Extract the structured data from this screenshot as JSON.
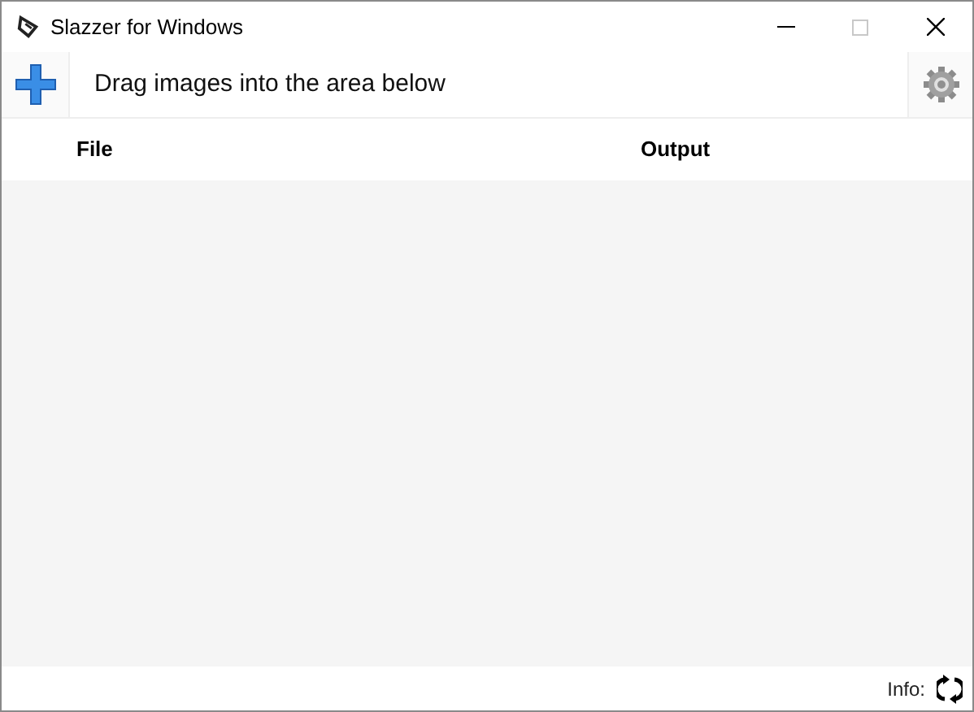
{
  "window": {
    "title": "Slazzer for Windows",
    "maximize_disabled": true
  },
  "toolbar": {
    "hint": "Drag images into the area below"
  },
  "table": {
    "columns": [
      "File",
      "Output"
    ]
  },
  "status_bar": {
    "label": "Info:"
  }
}
